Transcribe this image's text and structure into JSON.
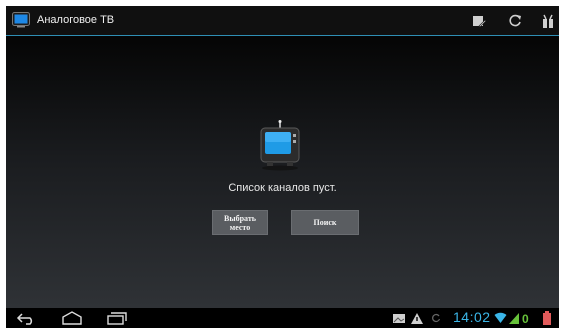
{
  "app_bar": {
    "title": "Аналоговое ТВ",
    "icons": [
      "tv-icon",
      "edit-list-icon",
      "refresh-icon",
      "antenna-settings-icon"
    ]
  },
  "main": {
    "empty_message": "Список каналов пуст.",
    "buttons": {
      "choose_place": "Выбрать\nместо",
      "search": "Поиск"
    }
  },
  "status_bar": {
    "time": "14:02",
    "icons": [
      "back-icon",
      "home-icon",
      "recent-apps-icon",
      "gallery-notification-icon",
      "warning-notification-icon",
      "sync-icon",
      "wifi-icon",
      "signal-icon",
      "battery-icon"
    ]
  },
  "colors": {
    "accent": "#3bb6e8",
    "button_bg": "#5a5d61"
  }
}
